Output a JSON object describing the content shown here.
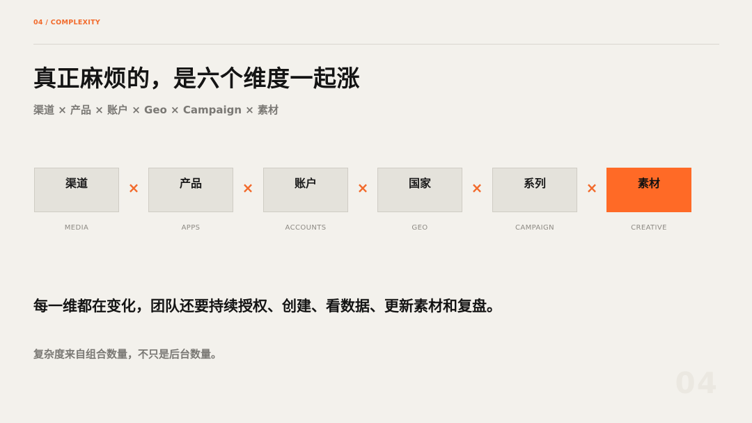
{
  "header": {
    "section_tag": "04 / COMPLEXITY",
    "title": "真正麻烦的，是六个维度一起涨",
    "subtitle": "渠道 × 产品 × 账户 × Geo × Campaign × 素材"
  },
  "dimensions": [
    {
      "label": "渠道",
      "en": "MEDIA",
      "active": false
    },
    {
      "label": "产品",
      "en": "APPS",
      "active": false
    },
    {
      "label": "账户",
      "en": "ACCOUNTS",
      "active": false
    },
    {
      "label": "国家",
      "en": "GEO",
      "active": false
    },
    {
      "label": "系列",
      "en": "CAMPAIGN",
      "active": false
    },
    {
      "label": "素材",
      "en": "CREATIVE",
      "active": true
    }
  ],
  "operator_symbol": "×",
  "statement": "每一维都在变化，团队还要持续授权、创建、看数据、更新素材和复盘。",
  "note": "复杂度来自组合数量，不只是后台数量。",
  "page_number": "04",
  "colors": {
    "accent": "#ff6a26",
    "background": "#f3f1ec",
    "box_fill": "#e4e2db",
    "muted_text": "#7a7874"
  }
}
